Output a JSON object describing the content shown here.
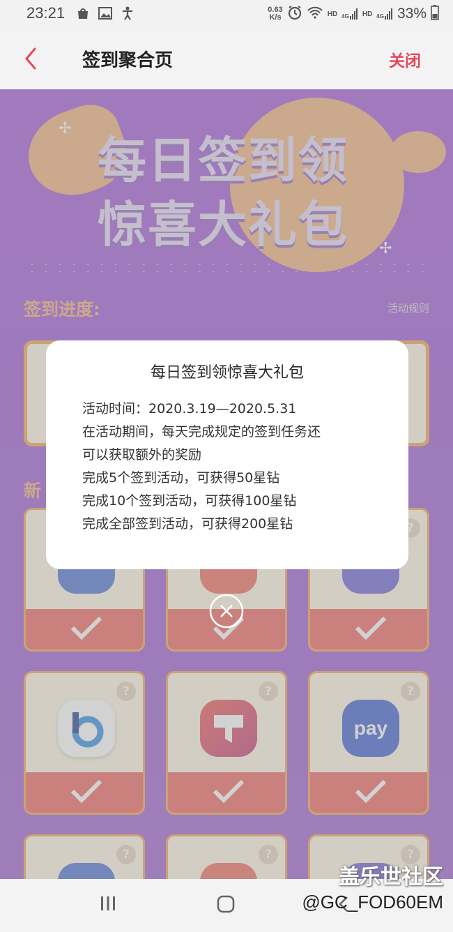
{
  "status_bar": {
    "time": "23:21",
    "speed_value": "0.63",
    "speed_unit": "K/s",
    "network_labels": [
      "HD",
      "4G",
      "HD",
      "4G"
    ],
    "battery": "33%"
  },
  "header": {
    "title": "签到聚合页",
    "close_label": "关闭"
  },
  "banner": {
    "line1": "每日签到领",
    "line2": "惊喜大礼包"
  },
  "progress": {
    "title": "签到进度:",
    "rules_link": "活动规则"
  },
  "new_section": {
    "title_prefix": "新"
  },
  "tiles": [
    {
      "app": "bixby-vision-icon",
      "color": "#4a6fd1",
      "q": "?"
    },
    {
      "app": "unknown-app-icon",
      "color": "#f06a5a",
      "q": "?"
    },
    {
      "app": "galaxy-buds-icon",
      "color": "#6c5fd6",
      "q": "?"
    },
    {
      "app": "bixby-icon",
      "color": "#ffffff",
      "q": "?"
    },
    {
      "app": "theme-store-icon",
      "color": "#e9516b",
      "q": "?"
    },
    {
      "app": "samsung-pay-icon",
      "color": "#3b5fcf",
      "q": "?",
      "label": "pay"
    },
    {
      "app": "smartthings-icon",
      "color": "#4a6fd1",
      "q": "?"
    },
    {
      "app": "samsung-notes-icon",
      "color": "#f06a5a",
      "q": "?"
    },
    {
      "app": "unknown-app-icon",
      "color": "#6c5fd6",
      "q": "?"
    }
  ],
  "dialog": {
    "title": "每日签到领惊喜大礼包",
    "lines": [
      "活动时间：2020.3.19—2020.5.31",
      "在活动期间，每天完成规定的签到任务还",
      "可以获取额外的奖励",
      "完成5个签到活动，可获得50星钻",
      "完成10个签到活动，可获得100星钻",
      "完成全部签到活动，可获得200星钻"
    ]
  },
  "watermark": {
    "line1": "盖乐世社区",
    "line2": "@GC_FOD60EM"
  },
  "colors": {
    "accent_red": "#e5485a",
    "purple_bg": "#a256d8",
    "orange": "#f1b07a",
    "check_bar": "#f0645c"
  }
}
